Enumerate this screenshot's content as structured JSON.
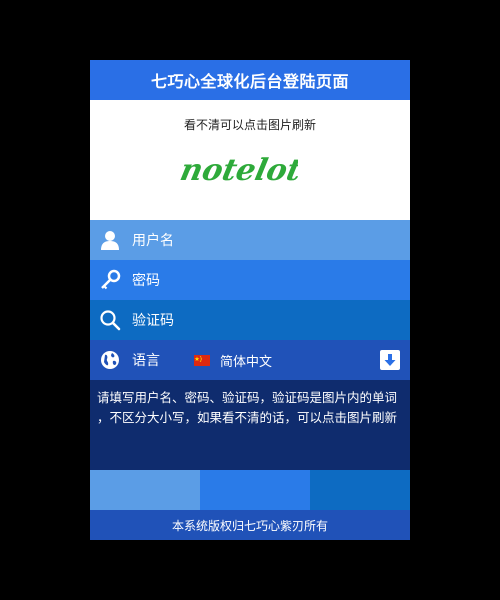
{
  "header": {
    "title": "七巧心全球化后台登陆页面"
  },
  "captcha": {
    "hint": "看不清可以点击图片刷新",
    "text": "notelot"
  },
  "form": {
    "username_label": "用户名",
    "password_label": "密码",
    "verification_label": "验证码",
    "language_label": "语言",
    "language_value": "简体中文"
  },
  "help": {
    "line1": "请填写用户名、密码、验证码，验证码是图片内的单词",
    "line2": "，不区分大小写，如果看不清的话，可以点击图片刷新"
  },
  "footer": {
    "copyright": "本系统版权归七巧心紫刃所有"
  },
  "icons": {
    "user": "user-icon",
    "key": "key-icon",
    "search": "search-icon",
    "globe": "globe-icon",
    "flag": "china-flag-icon",
    "dropdown": "arrow-down-icon"
  },
  "colors": {
    "header": "#2a6fe6",
    "row_user": "#5b9de6",
    "row_password": "#2a7be8",
    "row_code": "#0d6bc2",
    "row_language": "#2052b8",
    "help_bg": "#0f2c6e",
    "captcha_text": "#2eaa3a"
  }
}
